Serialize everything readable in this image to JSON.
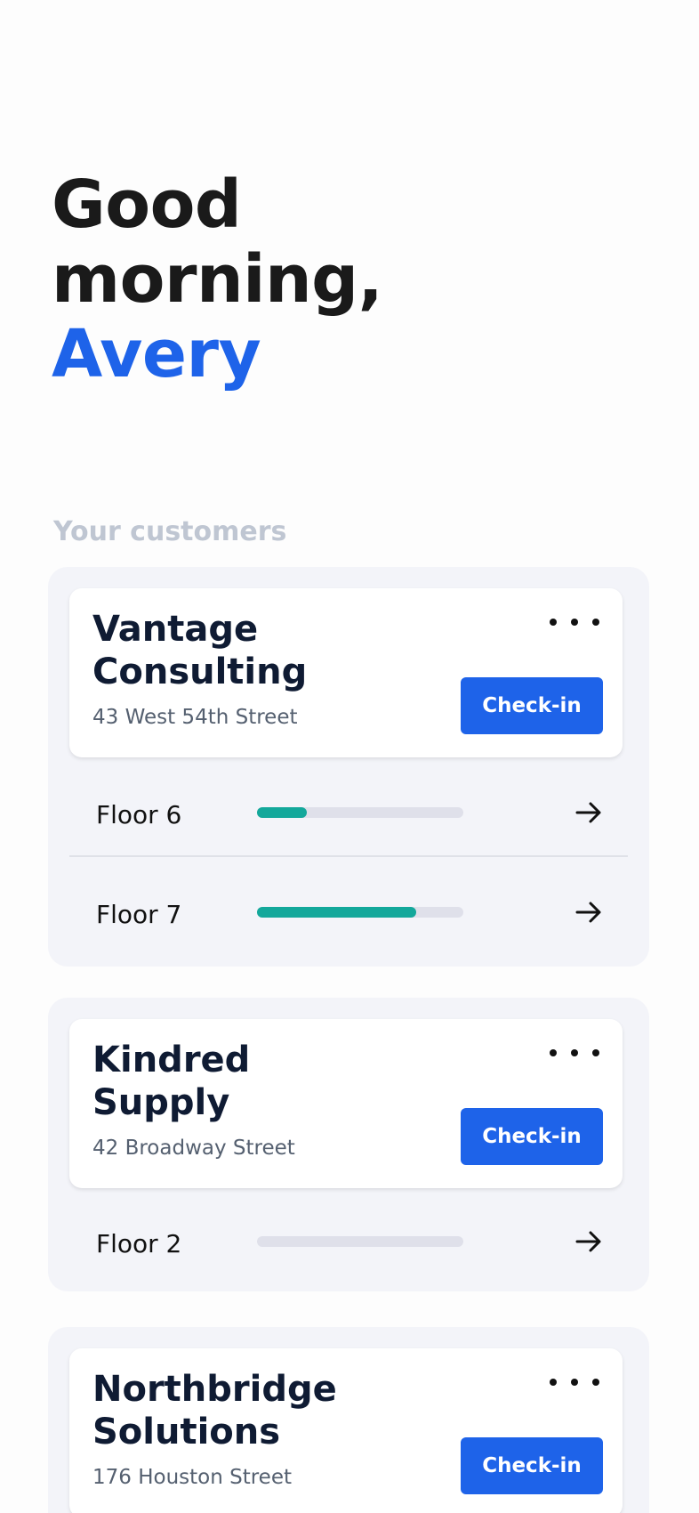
{
  "greeting": {
    "line1": "Good",
    "line2": "morning,",
    "name": "Avery"
  },
  "section_label": "Your customers",
  "colors": {
    "accent": "#1e63e9",
    "progress": "#13a89b",
    "track": "#dfe0ea"
  },
  "customers": [
    {
      "name_line1": "Vantage",
      "name_line2": "Consulting",
      "address": "43 West 54th Street",
      "checkin_label": "Check-in",
      "floors": [
        {
          "label": "Floor 6",
          "progress": 0.24
        },
        {
          "label": "Floor 7",
          "progress": 0.77
        }
      ]
    },
    {
      "name_line1": "Kindred",
      "name_line2": "Supply",
      "address": "42 Broadway Street",
      "checkin_label": "Check-in",
      "floors": [
        {
          "label": "Floor 2",
          "progress": 0
        }
      ]
    },
    {
      "name_line1": "Northbridge",
      "name_line2": "Solutions",
      "address": "176 Houston Street",
      "checkin_label": "Check-in",
      "floors": []
    }
  ]
}
